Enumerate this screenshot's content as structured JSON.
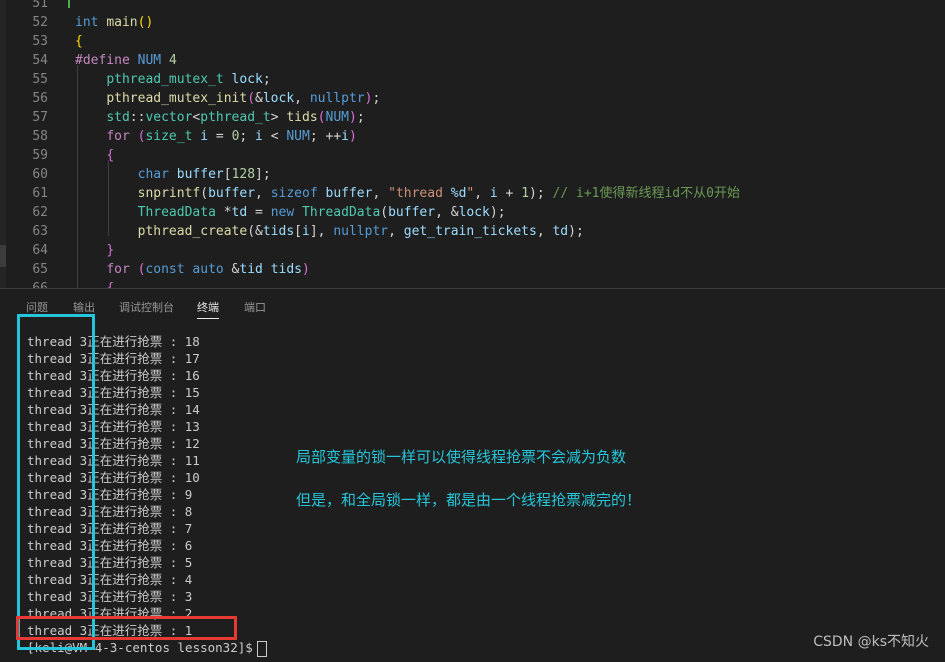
{
  "editor": {
    "lines": [
      {
        "num": "51",
        "segs": []
      },
      {
        "num": "52",
        "segs": [
          [
            "kw",
            "int "
          ],
          [
            "fn",
            "main"
          ],
          [
            "br",
            "()"
          ]
        ]
      },
      {
        "num": "53",
        "segs": [
          [
            "br",
            "{"
          ]
        ]
      },
      {
        "num": "54",
        "segs": [
          [
            "pp",
            "#define "
          ],
          [
            "mac",
            "NUM "
          ],
          [
            "num",
            "4"
          ]
        ]
      },
      {
        "num": "55",
        "segs": [
          [
            "",
            "    "
          ],
          [
            "ty",
            "pthread_mutex_t "
          ],
          [
            "var",
            "lock"
          ],
          [
            "",
            ";"
          ]
        ]
      },
      {
        "num": "56",
        "segs": [
          [
            "",
            "    "
          ],
          [
            "fn",
            "pthread_mutex_init"
          ],
          [
            "br2",
            "("
          ],
          [
            "",
            "&"
          ],
          [
            "var",
            "lock"
          ],
          [
            "",
            ", "
          ],
          [
            "kw",
            "nullptr"
          ],
          [
            "br2",
            ")"
          ],
          [
            "",
            ";"
          ]
        ]
      },
      {
        "num": "57",
        "segs": [
          [
            "",
            "    "
          ],
          [
            "ty",
            "std"
          ],
          [
            "",
            "::"
          ],
          [
            "ty",
            "vector"
          ],
          [
            "",
            "<"
          ],
          [
            "ty",
            "pthread_t"
          ],
          [
            "",
            "> "
          ],
          [
            "fn",
            "tids"
          ],
          [
            "br2",
            "("
          ],
          [
            "mac",
            "NUM"
          ],
          [
            "br2",
            ")"
          ],
          [
            "",
            ";"
          ]
        ]
      },
      {
        "num": "58",
        "segs": [
          [
            "",
            "    "
          ],
          [
            "ctl",
            "for "
          ],
          [
            "br2",
            "("
          ],
          [
            "ty",
            "size_t "
          ],
          [
            "var",
            "i"
          ],
          [
            "",
            " = "
          ],
          [
            "num",
            "0"
          ],
          [
            "",
            "; "
          ],
          [
            "var",
            "i"
          ],
          [
            "",
            " < "
          ],
          [
            "mac",
            "NUM"
          ],
          [
            "",
            "; ++"
          ],
          [
            "var",
            "i"
          ],
          [
            "br2",
            ")"
          ]
        ]
      },
      {
        "num": "59",
        "segs": [
          [
            "",
            "    "
          ],
          [
            "br2",
            "{"
          ]
        ]
      },
      {
        "num": "60",
        "segs": [
          [
            "",
            "        "
          ],
          [
            "kw",
            "char "
          ],
          [
            "var",
            "buffer"
          ],
          [
            "",
            "["
          ],
          [
            "num",
            "128"
          ],
          [
            "",
            "];"
          ]
        ]
      },
      {
        "num": "61",
        "segs": [
          [
            "",
            "        "
          ],
          [
            "fn",
            "snprintf"
          ],
          [
            "",
            "("
          ],
          [
            "var",
            "buffer"
          ],
          [
            "",
            ", "
          ],
          [
            "kw",
            "sizeof "
          ],
          [
            "var",
            "buffer"
          ],
          [
            "",
            ", "
          ],
          [
            "str",
            "\"thread "
          ],
          [
            "var",
            "%d"
          ],
          [
            "str",
            "\""
          ],
          [
            "",
            ", "
          ],
          [
            "var",
            "i"
          ],
          [
            "",
            " + "
          ],
          [
            "num",
            "1"
          ],
          [
            "",
            ");"
          ],
          [
            "cm",
            " // i+1使得新线程id不从0开始"
          ]
        ]
      },
      {
        "num": "62",
        "segs": [
          [
            "",
            "        "
          ],
          [
            "ty",
            "ThreadData "
          ],
          [
            "",
            "*"
          ],
          [
            "var",
            "td"
          ],
          [
            "",
            " = "
          ],
          [
            "kw",
            "new "
          ],
          [
            "ty",
            "ThreadData"
          ],
          [
            "",
            "("
          ],
          [
            "var",
            "buffer"
          ],
          [
            "",
            ", &"
          ],
          [
            "var",
            "lock"
          ],
          [
            "",
            ");"
          ]
        ]
      },
      {
        "num": "63",
        "segs": [
          [
            "",
            "        "
          ],
          [
            "fn",
            "pthread_create"
          ],
          [
            "",
            "(&"
          ],
          [
            "var",
            "tids"
          ],
          [
            "",
            "["
          ],
          [
            "var",
            "i"
          ],
          [
            "",
            "], "
          ],
          [
            "kw",
            "nullptr"
          ],
          [
            "",
            ", "
          ],
          [
            "var",
            "get_train_tickets"
          ],
          [
            "",
            ", "
          ],
          [
            "var",
            "td"
          ],
          [
            "",
            ");"
          ]
        ]
      },
      {
        "num": "64",
        "segs": [
          [
            "",
            "    "
          ],
          [
            "br2",
            "}"
          ]
        ]
      },
      {
        "num": "65",
        "segs": [
          [
            "",
            "    "
          ],
          [
            "ctl",
            "for "
          ],
          [
            "br2",
            "("
          ],
          [
            "kw",
            "const auto "
          ],
          [
            "",
            "&"
          ],
          [
            "var",
            "tid "
          ],
          [
            ": "
          ],
          [
            "var",
            "tids"
          ],
          [
            "br2",
            ")"
          ]
        ]
      },
      {
        "num": "66",
        "segs": [
          [
            "",
            "    "
          ],
          [
            "br2",
            "{"
          ]
        ]
      }
    ]
  },
  "panel": {
    "tabs": [
      "问题",
      "输出",
      "调试控制台",
      "终端",
      "端口"
    ],
    "active_tab": "终端"
  },
  "terminal": {
    "lines": [
      "thread 3正在进行抢票 : 18",
      "thread 3正在进行抢票 : 17",
      "thread 3正在进行抢票 : 16",
      "thread 3正在进行抢票 : 15",
      "thread 3正在进行抢票 : 14",
      "thread 3正在进行抢票 : 13",
      "thread 3正在进行抢票 : 12",
      "thread 3正在进行抢票 : 11",
      "thread 3正在进行抢票 : 10",
      "thread 3正在进行抢票 : 9",
      "thread 3正在进行抢票 : 8",
      "thread 3正在进行抢票 : 7",
      "thread 3正在进行抢票 : 6",
      "thread 3正在进行抢票 : 5",
      "thread 3正在进行抢票 : 4",
      "thread 3正在进行抢票 : 3",
      "thread 3正在进行抢票 : 2",
      "thread 3正在进行抢票 : 1"
    ],
    "prompt": "[keli@VM-4-3-centos lesson32]$"
  },
  "annotations": {
    "line1": "局部变量的锁一样可以使得线程抢票不会减为负数",
    "line2": "但是，和全局锁一样，都是由一个线程抢票减完的！"
  },
  "watermark": "CSDN @ks不知火",
  "colors": {
    "box_cyan": "#26c6da",
    "box_red": "#e53935",
    "annotation": "#26c6da"
  }
}
